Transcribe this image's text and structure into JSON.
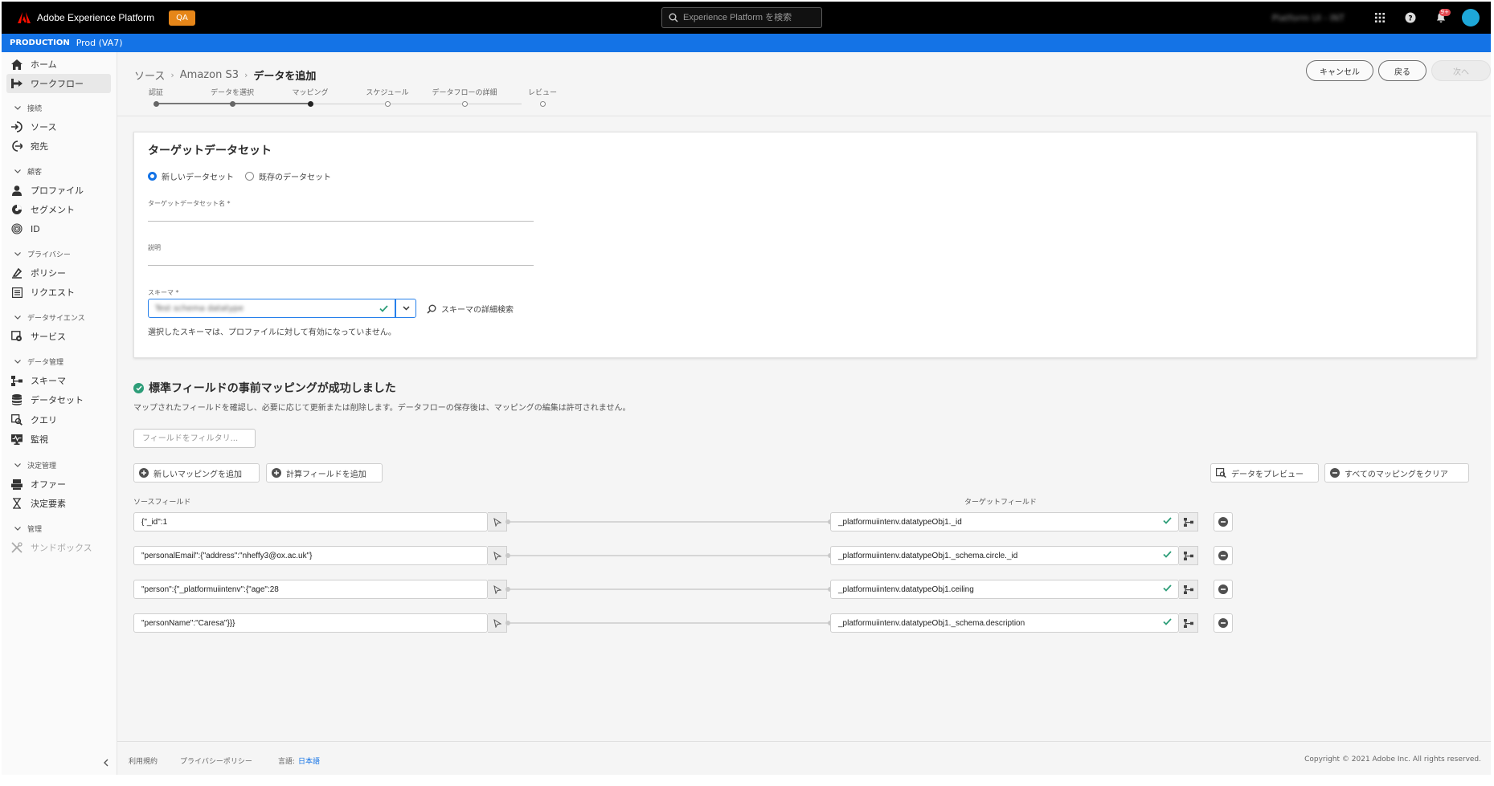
{
  "app": {
    "title": "Adobe Experience Platform",
    "env_badge": "QA",
    "search_placeholder": "Experience Platform を検索",
    "org_name": "Platform UI - INT",
    "notification_count": "9+",
    "colors": {
      "accent": "#1473e6",
      "badge": "#e68619",
      "success": "#2d9d78"
    }
  },
  "env": {
    "label": "PRODUCTION",
    "value": "Prod (VA7)"
  },
  "sidebar": {
    "home": "ホーム",
    "workflows": "ワークフロー",
    "sec_connections": "接続",
    "sources": "ソース",
    "destinations": "宛先",
    "sec_customer": "顧客",
    "profiles": "プロファイル",
    "segments": "セグメント",
    "identities": "ID",
    "sec_privacy": "プライバシー",
    "policies": "ポリシー",
    "requests": "リクエスト",
    "sec_datascience": "データサイエンス",
    "services": "サービス",
    "sec_datamgmt": "データ管理",
    "schemas": "スキーマ",
    "datasets": "データセット",
    "queries": "クエリ",
    "monitoring": "監視",
    "sec_decision": "決定管理",
    "offers": "オファー",
    "decision_elements": "決定要素",
    "sec_admin": "管理",
    "sandboxes": "サンドボックス"
  },
  "breadcrumb": {
    "root": "ソース",
    "parent": "Amazon S3",
    "current": "データを追加"
  },
  "header_buttons": {
    "cancel": "キャンセル",
    "back": "戻る",
    "next": "次へ"
  },
  "steps": [
    "認証",
    "データを選択",
    "マッピング",
    "スケジュール",
    "データフローの詳細",
    "レビュー"
  ],
  "target": {
    "title": "ターゲットデータセット",
    "radio_new": "新しいデータセット",
    "radio_existing": "既存のデータセット",
    "name_label": "ターゲットデータセット名 *",
    "desc_label": "説明",
    "schema_label": "スキーマ *",
    "schema_value": "Test schema datatype",
    "advanced_search": "スキーマの詳細検索",
    "schema_help": "選択したスキーマは、プロファイルに対して有効になっていません。"
  },
  "mapping": {
    "success_title": "標準フィールドの事前マッピングが成功しました",
    "success_desc": "マップされたフィールドを確認し、必要に応じて更新または削除します。データフローの保存後は、マッピングの編集は許可されません。",
    "filter_placeholder": "フィールドをフィルタリ...",
    "add_mapping": "新しいマッピングを追加",
    "add_calculated": "計算フィールドを追加",
    "preview_data": "データをプレビュー",
    "clear_all": "すべてのマッピングをクリア",
    "source_header": "ソースフィールド",
    "target_header": "ターゲットフィールド",
    "rows": [
      {
        "source": "{\"_id\":1",
        "target": "_platformuiintenv.datatypeObj1._id"
      },
      {
        "source": "\"personalEmail\":{\"address\":\"nheffy3@ox.ac.uk\"}",
        "target": "_platformuiintenv.datatypeObj1._schema.circle._id"
      },
      {
        "source": "\"person\":{\"_platformuiintenv\":{\"age\":28",
        "target": "_platformuiintenv.datatypeObj1.ceiling"
      },
      {
        "source": "\"personName\":\"Caresa\"}}}",
        "target": "_platformuiintenv.datatypeObj1._schema.description"
      }
    ]
  },
  "footer": {
    "terms": "利用規約",
    "privacy": "プライバシーポリシー",
    "language_label": "言語:",
    "language": "日本語",
    "copyright": "Copyright © 2021 Adobe Inc. All rights reserved."
  }
}
